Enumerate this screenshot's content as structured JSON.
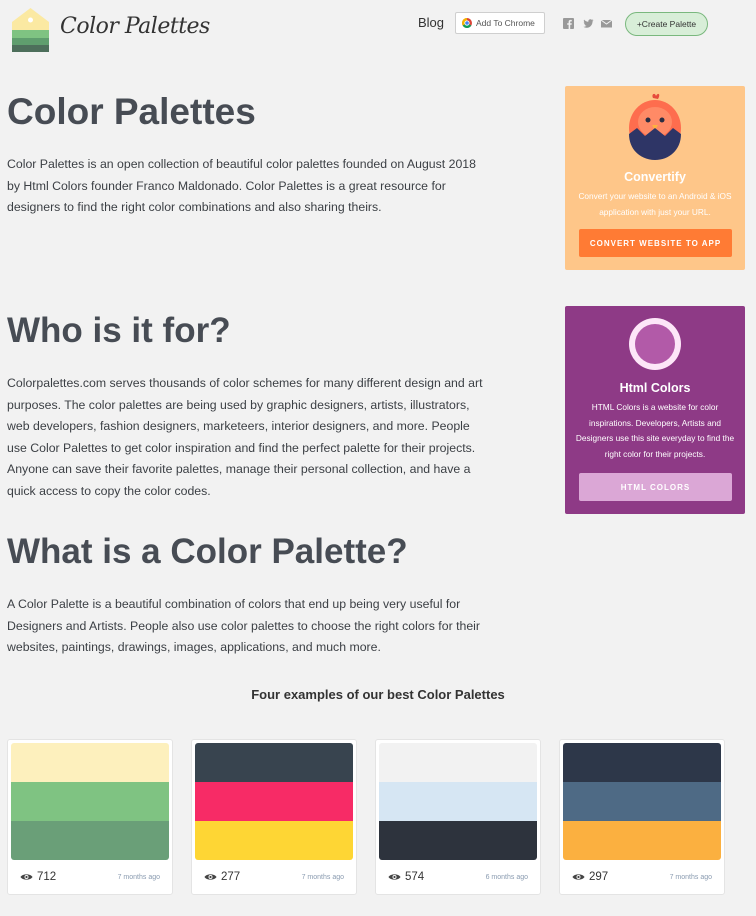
{
  "header": {
    "logo_text": "Color Palettes",
    "blog_label": "Blog",
    "chrome_label": "Add To Chrome",
    "social_icons": [
      "facebook-icon",
      "twitter-icon",
      "mail-icon"
    ],
    "create_label": "+Create Palette"
  },
  "main": {
    "title": "Color Palettes",
    "intro": "Color Palettes is an open collection of beautiful color palettes founded on August 2018 by Html Colors founder Franco Maldonado. Color Palettes is a great resource for designers to find the right color combinations and also sharing theirs.",
    "who_title": "Who is it for?",
    "who_text": "Colorpalettes.com serves thousands of color schemes for many different design and art purposes. The color palettes are being used by graphic designers, artists, illustrators, web developers, fashion designers, marketeers, interior designers, and more. People use Color Palettes to get color inspiration and find the perfect palette for their projects. Anyone can save their favorite palettes, manage their personal collection, and have a quick access to copy the color codes.",
    "what_title": "What is a Color Palette?",
    "what_text": "A Color Palette is a beautiful combination of colors that end up being very useful for Designers and Artists. People also use color palettes to choose the right colors for their websites, paintings, drawings, images, applications, and much more.",
    "examples_title": "Four examples of our best Color Palettes"
  },
  "ads": {
    "convertify": {
      "title": "Convertify",
      "desc": "Convert your website to an Android & iOS application with just your URL.",
      "button": "CONVERT WEBSITE TO APP",
      "bg": "#fec689",
      "button_color": "#ff7b34"
    },
    "htmlcolors": {
      "title": "Html Colors",
      "desc": "HTML Colors is a website for color inspirations. Developers, Artists and Designers use this site everyday to find the right color for their projects.",
      "button": "HTML COLORS",
      "bg": "#8e3a86",
      "button_color": "#dba7d6"
    }
  },
  "palettes": [
    {
      "colors": [
        "#fdf0bd",
        "#7fc382",
        "#6a9f78"
      ],
      "views": "712",
      "age": "7 months ago"
    },
    {
      "colors": [
        "#38444f",
        "#f72b66",
        "#fed634"
      ],
      "views": "277",
      "age": "7 months ago"
    },
    {
      "colors": [
        "#f2f2f2",
        "#d6e6f3",
        "#2d333d"
      ],
      "views": "574",
      "age": "6 months ago"
    },
    {
      "colors": [
        "#2d3749",
        "#4e6a85",
        "#fbb040"
      ],
      "views": "297",
      "age": "7 months ago"
    }
  ]
}
